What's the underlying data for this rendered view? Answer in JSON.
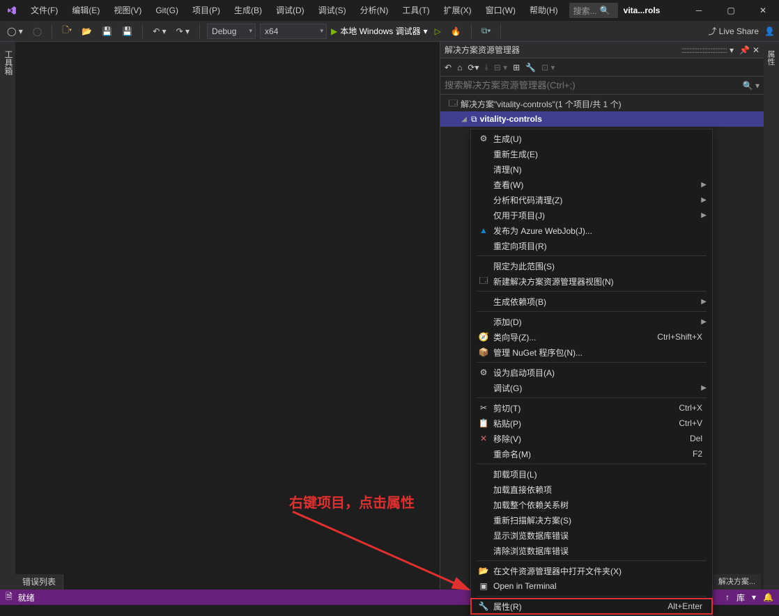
{
  "titlebar": {
    "menu": [
      "文件(F)",
      "编辑(E)",
      "视图(V)",
      "Git(G)",
      "项目(P)",
      "生成(B)",
      "调试(D)",
      "调试(S)",
      "分析(N)",
      "工具(T)",
      "扩展(X)",
      "窗口(W)",
      "帮助(H)"
    ],
    "search_placeholder": "搜索...",
    "project": "vita...rols"
  },
  "toolbar": {
    "config": "Debug",
    "platform": "x64",
    "run_label": "本地 Windows 调试器",
    "live_share": "Live Share"
  },
  "left_tab": "工具箱",
  "right_tab": "属性",
  "solution": {
    "title": "解决方案资源管理器",
    "search_placeholder": "搜索解决方案资源管理器(Ctrl+;)",
    "root": "解决方案\"vitality-controls\"(1 个项目/共 1 个)",
    "project": "vitality-controls"
  },
  "bottom_tabs": {
    "error_list": "错误列表",
    "soln_explorer": "解决方案..."
  },
  "statusbar": {
    "ready": "就绪",
    "repo": "库"
  },
  "context_menu": {
    "items": [
      {
        "label": "生成(U)",
        "icon": "build"
      },
      {
        "label": "重新生成(E)"
      },
      {
        "label": "清理(N)"
      },
      {
        "label": "查看(W)",
        "sub": true
      },
      {
        "label": "分析和代码清理(Z)",
        "sub": true
      },
      {
        "label": "仅用于项目(J)",
        "sub": true
      },
      {
        "label": "发布为 Azure WebJob(J)...",
        "icon": "azure"
      },
      {
        "label": "重定向项目(R)"
      },
      {
        "sep": true
      },
      {
        "label": "限定为此范围(S)"
      },
      {
        "label": "新建解决方案资源管理器视图(N)",
        "icon": "newview"
      },
      {
        "sep": true
      },
      {
        "label": "生成依赖项(B)",
        "sub": true
      },
      {
        "sep": true
      },
      {
        "label": "添加(D)",
        "sub": true
      },
      {
        "label": "类向导(Z)...",
        "icon": "wizard",
        "shortcut": "Ctrl+Shift+X"
      },
      {
        "label": "管理 NuGet 程序包(N)...",
        "icon": "nuget"
      },
      {
        "sep": true
      },
      {
        "label": "设为启动项目(A)",
        "icon": "startup"
      },
      {
        "label": "调试(G)",
        "sub": true
      },
      {
        "sep": true
      },
      {
        "label": "剪切(T)",
        "icon": "cut",
        "shortcut": "Ctrl+X"
      },
      {
        "label": "粘贴(P)",
        "icon": "paste",
        "shortcut": "Ctrl+V"
      },
      {
        "label": "移除(V)",
        "icon": "remove",
        "shortcut": "Del"
      },
      {
        "label": "重命名(M)",
        "shortcut": "F2"
      },
      {
        "sep": true
      },
      {
        "label": "卸载项目(L)"
      },
      {
        "label": "加载直接依赖项"
      },
      {
        "label": "加载整个依赖关系树"
      },
      {
        "label": "重新扫描解决方案(S)"
      },
      {
        "label": "显示浏览数据库错误"
      },
      {
        "label": "清除浏览数据库错误"
      },
      {
        "sep": true
      },
      {
        "label": "在文件资源管理器中打开文件夹(X)",
        "icon": "folder"
      },
      {
        "label": "Open in Terminal",
        "icon": "terminal"
      },
      {
        "sep": true
      },
      {
        "label": "属性(R)",
        "icon": "wrench",
        "shortcut": "Alt+Enter",
        "highlight": true
      }
    ]
  },
  "annotation": "右键项目，点击属性"
}
